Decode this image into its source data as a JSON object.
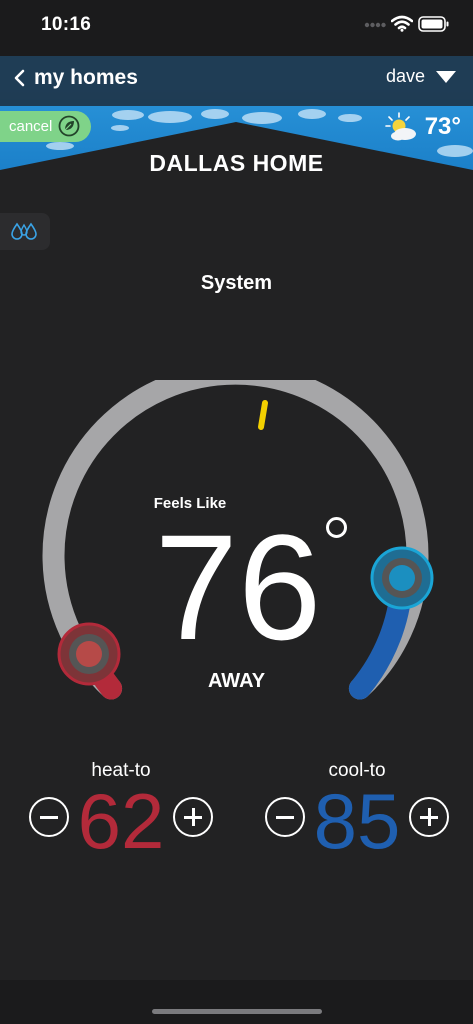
{
  "status": {
    "time": "10:16"
  },
  "nav": {
    "back_label": "my homes",
    "user_label": "dave"
  },
  "promo": {
    "cancel_label": "cancel"
  },
  "weather": {
    "temp": "73°",
    "icon": "partly-sunny-icon"
  },
  "home": {
    "title": "DALLAS HOME"
  },
  "system": {
    "label": "System"
  },
  "dial": {
    "feels_like_label": "Feels Like",
    "current_temp": "76",
    "mode": "AWAY",
    "colors": {
      "heat": "#b32a3a",
      "cool": "#1f5fb0",
      "track": "#a6a6a8",
      "indicator": "#f3d000"
    }
  },
  "heat": {
    "label": "heat-to",
    "value": "62"
  },
  "cool": {
    "label": "cool-to",
    "value": "85"
  }
}
